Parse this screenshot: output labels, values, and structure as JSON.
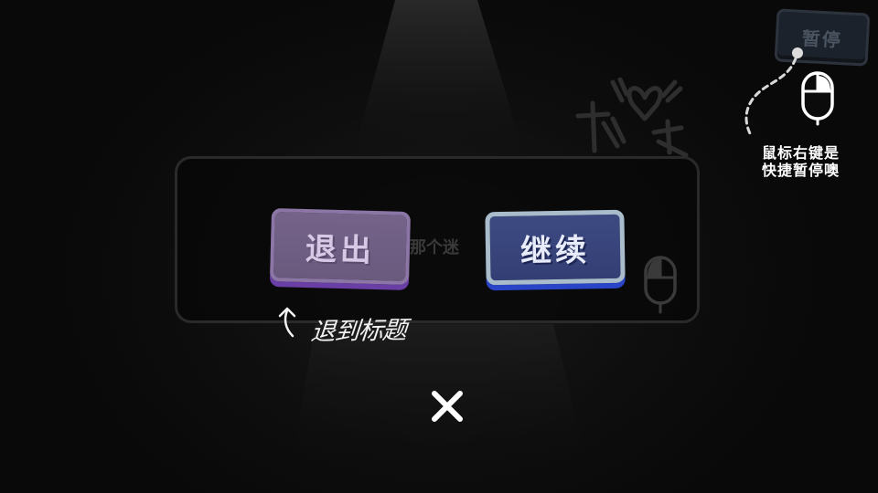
{
  "pause_button": {
    "label": "暂停"
  },
  "hint": {
    "line1": "鼠标右键是",
    "line2": "快捷暂停噢"
  },
  "dialog": {
    "exit_label": "退出",
    "continue_label": "继续",
    "ghost_text": "那个迷",
    "annotation": "退到标题"
  },
  "icons": {
    "mouse": "mouse-icon",
    "close": "close-icon",
    "arrow": "curved-arrow-icon"
  },
  "colors": {
    "exit_button": "#756389",
    "continue_button": "#3d4a82",
    "continue_border": "#a9bccb",
    "background": "#0b0b0b"
  }
}
